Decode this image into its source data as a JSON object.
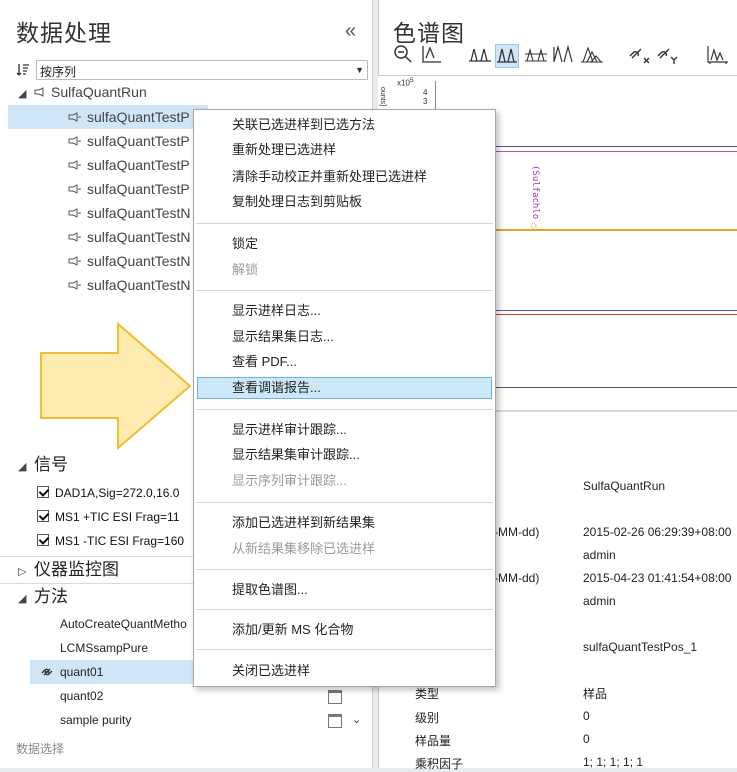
{
  "left_panel": {
    "title": "数据处理",
    "collapse_glyph": "«",
    "sort_value": "按序列",
    "tree_root": "SulfaQuantRun",
    "tree_items": [
      "sulfaQuantTestP",
      "sulfaQuantTestP",
      "sulfaQuantTestP",
      "sulfaQuantTestP",
      "sulfaQuantTestN",
      "sulfaQuantTestN",
      "sulfaQuantTestN",
      "sulfaQuantTestN"
    ],
    "signal_header": "信号",
    "signals": [
      "DAD1A,Sig=272.0,16.0",
      "MS1  +TIC ESI Frag=11",
      "MS1  -TIC ESI Frag=160"
    ],
    "instrument_header": "仪器监控图",
    "method_header": "方法",
    "methods": [
      "AutoCreateQuantMetho",
      "LCMSsampPure",
      "quant01",
      "quant02",
      "sample purity"
    ],
    "footer": "数据选择"
  },
  "right_panel": {
    "title": "色谱图",
    "y_scale_label": "x10",
    "y_scale_exp": "5",
    "y_ticks": [
      "4",
      "3"
    ],
    "y_axis_unit": "ounts]",
    "compound_label": "(Sulfachlo",
    "props": [
      {
        "label": "",
        "value": "SulfaQuantRun"
      },
      {
        "label": "-MM-dd)",
        "value": "2015-02-26 06:29:39+08:00"
      },
      {
        "label": "",
        "value": "admin"
      },
      {
        "label": "-MM-dd)",
        "value": "2015-04-23 01:41:54+08:00"
      },
      {
        "label": "",
        "value": "admin"
      },
      {
        "label": "",
        "value": "sulfaQuantTestPos_1"
      },
      {
        "label": "类型",
        "value": "样品"
      },
      {
        "label": "级别",
        "value": "0"
      },
      {
        "label": "样品量",
        "value": "0"
      },
      {
        "label": "乘积因子",
        "value": "1; 1; 1; 1; 1"
      }
    ]
  },
  "context_menu": {
    "items": [
      "关联已选进样到已选方法",
      "重新处理已选进样",
      "清除手动校正并重新处理已选进样",
      "复制处理日志到剪贴板",
      "锁定",
      "解锁",
      "显示进样日志...",
      "显示结果集日志...",
      "查看 PDF...",
      "查看调谐报告...",
      "显示进样审计跟踪...",
      "显示结果集审计跟踪...",
      "显示序列审计跟踪...",
      "添加已选进样到新结果集",
      "从新结果集移除已选进样",
      "提取色谱图...",
      "添加/更新 MS 化合物",
      "关闭已选进样"
    ],
    "highlighted_index": 9,
    "disabled_indices": [
      5,
      12,
      14
    ]
  },
  "colors": {
    "selection": "#cfe6f8",
    "arrow_fill": "#fde9a8",
    "arrow_stroke": "#f0be32"
  }
}
